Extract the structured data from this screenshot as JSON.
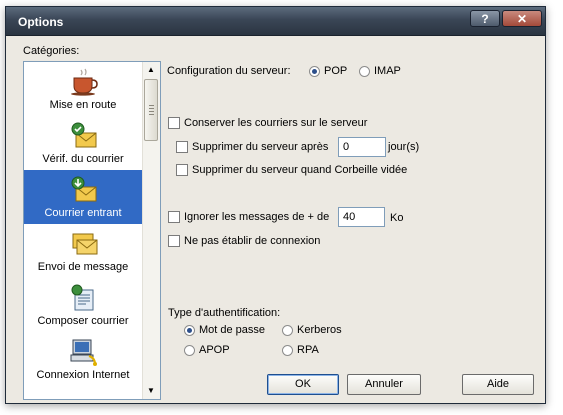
{
  "window": {
    "title": "Options",
    "help_label": "?",
    "close_label": "✕"
  },
  "categories": {
    "label": "Catégories:",
    "items": [
      {
        "label": "Mise en route",
        "icon": "coffee-cup-icon",
        "selected": false
      },
      {
        "label": "Vérif. du courrier",
        "icon": "check-mail-icon",
        "selected": false
      },
      {
        "label": "Courrier entrant",
        "icon": "incoming-mail-icon",
        "selected": true
      },
      {
        "label": "Envoi de message",
        "icon": "send-message-icon",
        "selected": false
      },
      {
        "label": "Composer courrier",
        "icon": "compose-mail-icon",
        "selected": false
      },
      {
        "label": "Connexion Internet",
        "icon": "internet-connection-icon",
        "selected": false
      }
    ]
  },
  "server": {
    "label": "Configuration du serveur:",
    "options": [
      {
        "label": "POP",
        "checked": true
      },
      {
        "label": "IMAP",
        "checked": false
      }
    ]
  },
  "keep_on_server": {
    "label": "Conserver les courriers sur le serveur",
    "checked": false
  },
  "delete_after": {
    "label": "Supprimer du serveur après",
    "value": "0",
    "unit": "jour(s)",
    "checked": false
  },
  "delete_trash": {
    "label": "Supprimer du serveur quand Corbeille vidée",
    "checked": false
  },
  "ignore_over": {
    "label": "Ignorer les messages de + de",
    "value": "40",
    "unit": "Ko",
    "checked": false
  },
  "no_connection": {
    "label": "Ne pas établir de connexion",
    "checked": false
  },
  "auth": {
    "label": "Type d'authentification:",
    "options": [
      {
        "label": "Mot de passe",
        "checked": true
      },
      {
        "label": "Kerberos",
        "checked": false
      },
      {
        "label": "APOP",
        "checked": false
      },
      {
        "label": "RPA",
        "checked": false
      }
    ]
  },
  "buttons": {
    "ok": "OK",
    "cancel": "Annuler",
    "help": "Aide"
  },
  "colors": {
    "selection": "#316ac5",
    "titlebar": "#3a4656",
    "dialog_bg": "#ece9e2"
  }
}
